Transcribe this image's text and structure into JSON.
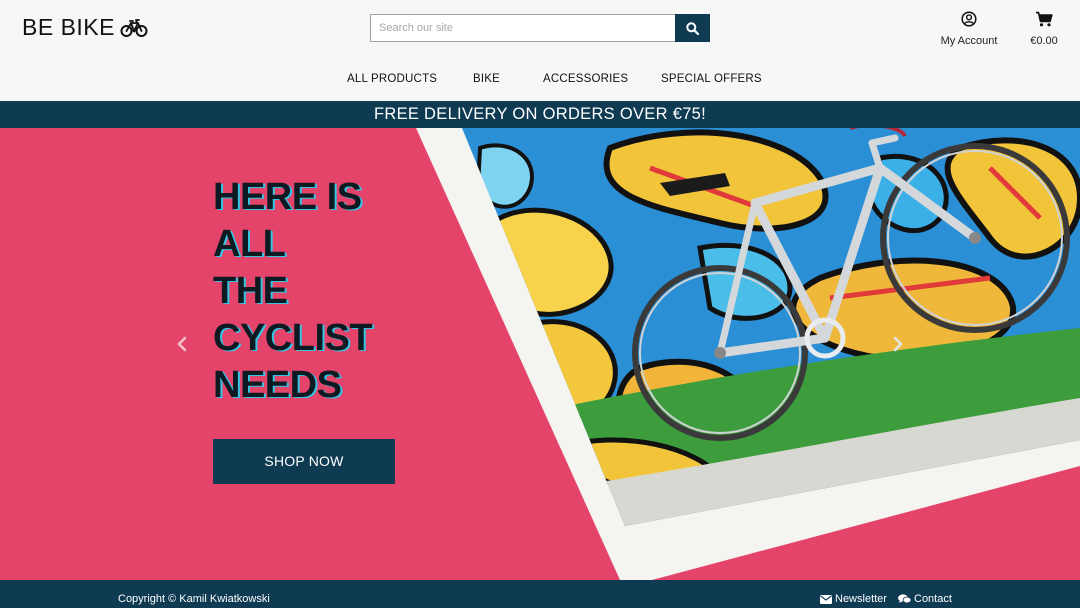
{
  "brand": {
    "name": "BE BIKE",
    "icon": "bicycle-icon"
  },
  "search": {
    "placeholder": "Search our site",
    "button_icon": "search-icon"
  },
  "account": {
    "label": "My Account",
    "icon": "user-circle-icon"
  },
  "cart": {
    "total": "€0.00",
    "icon": "shopping-cart-icon"
  },
  "nav": {
    "items": [
      {
        "label": "ALL PRODUCTS"
      },
      {
        "label": "BIKE"
      },
      {
        "label": "ACCESSORIES"
      },
      {
        "label": "SPECIAL OFFERS"
      }
    ]
  },
  "promo": {
    "text": "FREE DELIVERY ON ORDERS OVER €75!"
  },
  "hero": {
    "headline_lines": [
      "HERE IS",
      "ALL",
      "THE",
      "CYCLIST",
      "NEEDS"
    ],
    "cta": "SHOP NOW",
    "prev_icon": "chevron-left-icon",
    "next_icon": "chevron-right-icon"
  },
  "footer": {
    "copyright": "Copyright © Kamil Kwiatkowski",
    "links": [
      {
        "label": "Newsletter",
        "icon": "envelope-icon"
      },
      {
        "label": "Contact",
        "icon": "chat-icon"
      }
    ]
  },
  "colors": {
    "primary": "#0e3a52",
    "hero_background": "#e5446a",
    "headline_shadow": "#35c5e3",
    "header_background": "#f7f7f7"
  }
}
